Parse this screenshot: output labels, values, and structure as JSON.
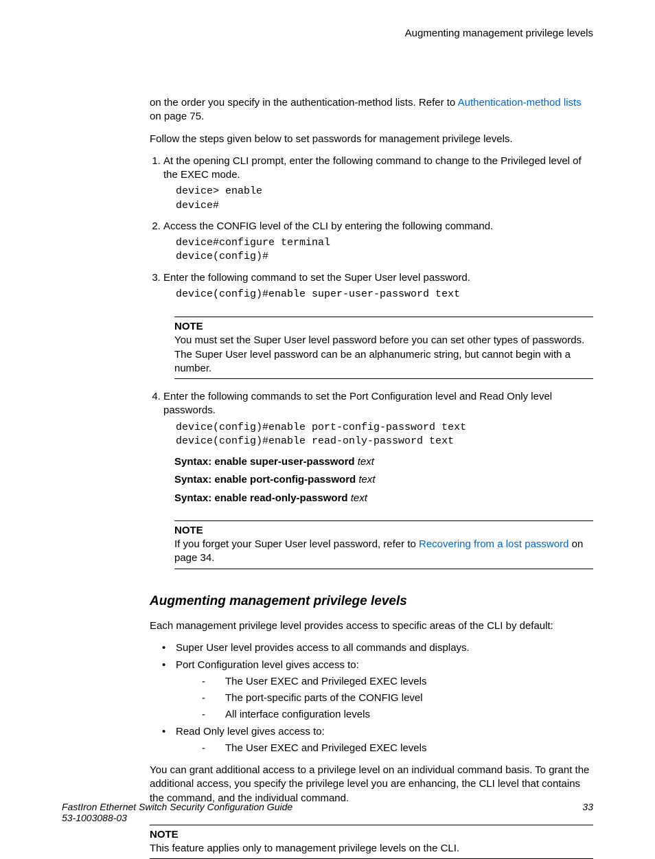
{
  "running_head": "Augmenting management privilege levels",
  "intro_para_1a": "on the order you specify in the authentication-method lists. Refer to ",
  "intro_link": "Authentication-method lists",
  "intro_para_1b": " on page 75.",
  "intro_para_2": "Follow the steps given below to set passwords for management privilege levels.",
  "steps": {
    "s1": "At the opening CLI prompt, enter the following command to change to the Privileged level of the EXEC mode.",
    "c1": "device> enable\ndevice#",
    "s2": "Access the CONFIG level of the CLI by entering the following command.",
    "c2": "device#configure terminal\ndevice(config)#",
    "s3": "Enter the following command to set the Super User level password.",
    "c3": "device(config)#enable super-user-password text",
    "s4": "Enter the following commands to set the Port Configuration level and Read Only level passwords.",
    "c4": "device(config)#enable port-config-password text\ndevice(config)#enable read-only-password text"
  },
  "note1_label": "NOTE",
  "note1_text": "You must set the Super User level password before you can set other types of passwords. The Super User level password can be an alphanumeric string, but cannot begin with a number.",
  "syntax": {
    "s1b": "Syntax: enable super-user-password",
    "s1i": " text",
    "s2b": "Syntax: enable port-config-password",
    "s2i": " text",
    "s3b": "Syntax: enable read-only-password",
    "s3i": " text"
  },
  "note2_label": "NOTE",
  "note2_a": "If you forget your Super User level password, refer to ",
  "note2_link": "Recovering from a lost password",
  "note2_b": " on page 34.",
  "section_heading": "Augmenting management privilege levels",
  "section_intro": "Each management privilege level provides access to specific areas of the CLI by default:",
  "b1": "Super User level provides access to all commands and displays.",
  "b2": "Port Configuration level gives access to:",
  "b2_1": "The User EXEC and Privileged EXEC levels",
  "b2_2": "The port-specific parts of the CONFIG level",
  "b2_3": "All interface configuration levels",
  "b3": "Read Only level gives access to:",
  "b3_1": "The User EXEC and Privileged EXEC levels",
  "after_list": "You can grant additional access to a privilege level on an individual command basis. To grant the additional access, you specify the privilege level you are enhancing, the CLI level that contains the command, and the individual command.",
  "note3_label": "NOTE",
  "note3_text": "This feature applies only to management privilege levels on the CLI.",
  "footer_title": "FastIron Ethernet Switch Security Configuration Guide",
  "footer_docnum": "53-1003088-03",
  "page_number": "33"
}
